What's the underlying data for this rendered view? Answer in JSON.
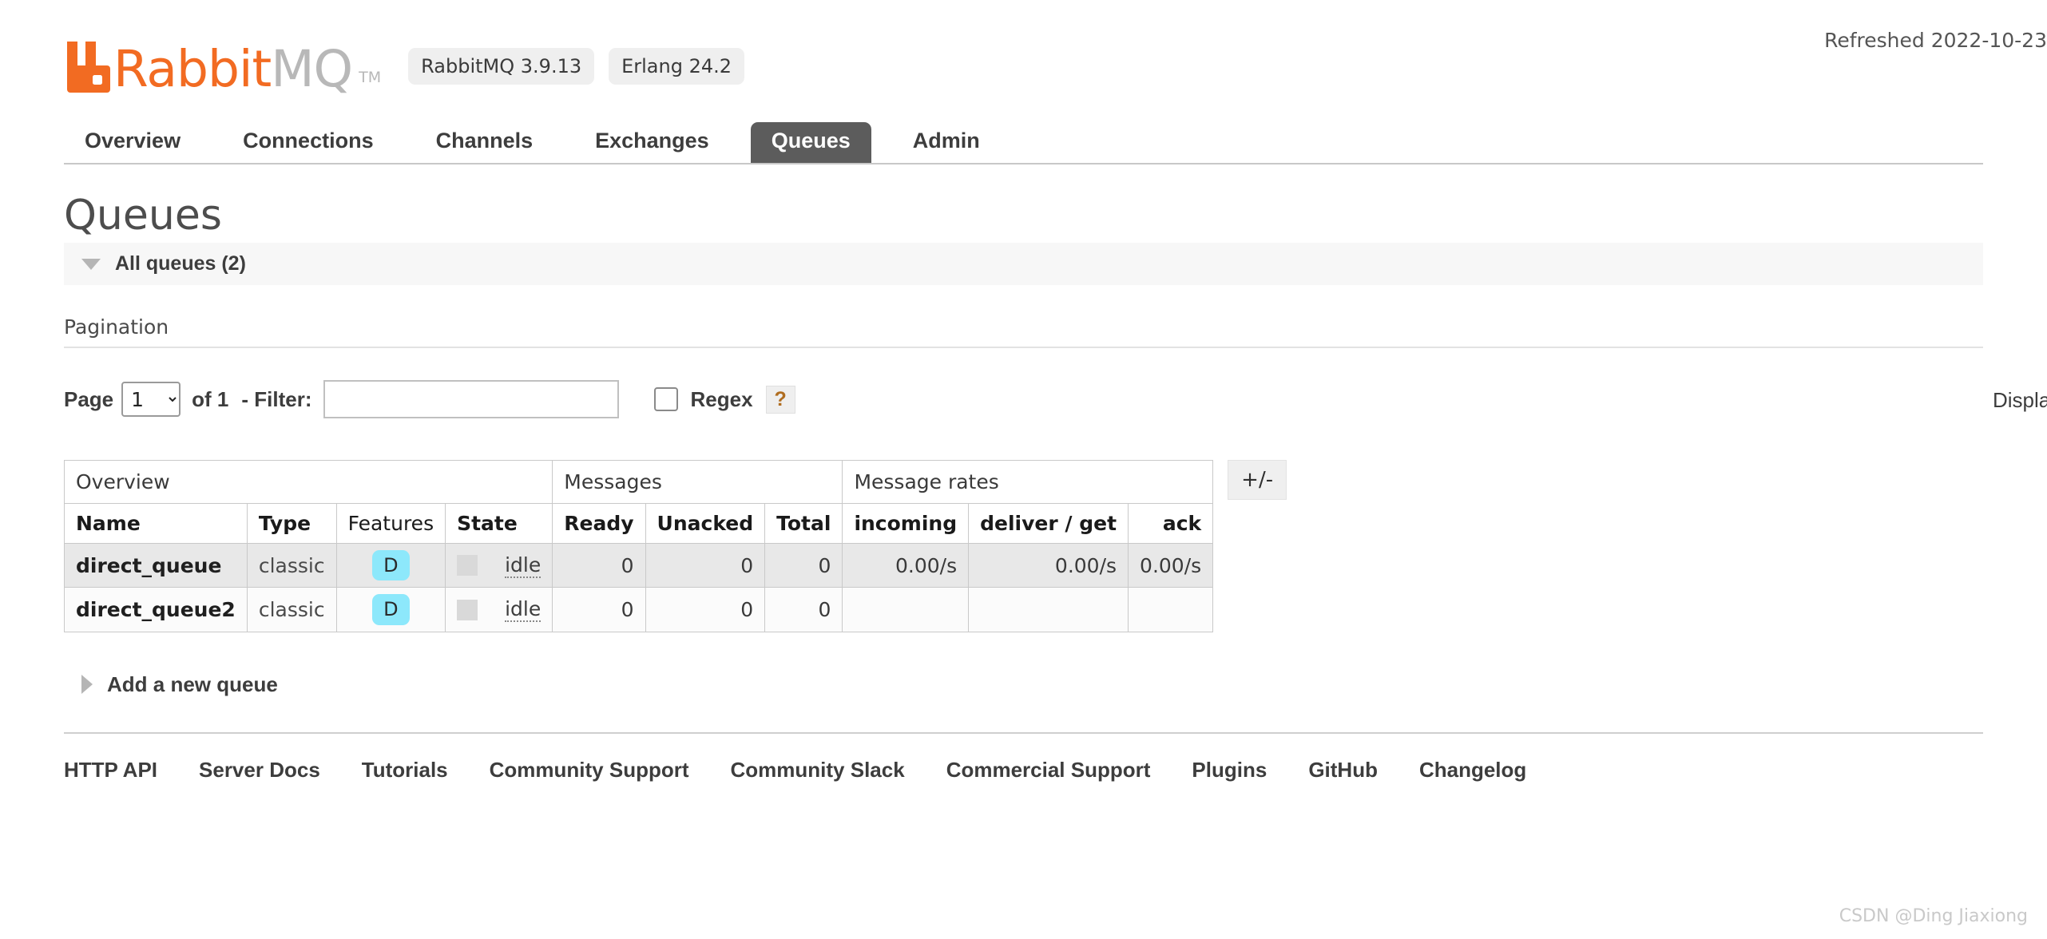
{
  "header": {
    "logo": {
      "mark_icon": "rabbitmq-logo-icon",
      "text_primary": "Rabbit",
      "text_secondary": "MQ",
      "trademark": "TM",
      "color_orange": "#f26b22",
      "color_grey": "#b8b8b8"
    },
    "badges": [
      {
        "label": "RabbitMQ 3.9.13"
      },
      {
        "label": "Erlang 24.2"
      }
    ],
    "refreshed": "Refreshed 2022-10-23"
  },
  "nav": {
    "tabs": [
      {
        "label": "Overview",
        "active": false
      },
      {
        "label": "Connections",
        "active": false
      },
      {
        "label": "Channels",
        "active": false
      },
      {
        "label": "Exchanges",
        "active": false
      },
      {
        "label": "Queues",
        "active": true
      },
      {
        "label": "Admin",
        "active": false
      }
    ]
  },
  "main": {
    "page_title": "Queues",
    "all_queues_section": "All queues (2)",
    "pagination_heading": "Pagination",
    "filter": {
      "page_label": "Page",
      "page_value": "1",
      "page_options": [
        "1"
      ],
      "of_label": "of 1",
      "filter_label": "- Filter:",
      "filter_value": "",
      "filter_placeholder": "",
      "regex_label": "Regex",
      "regex_checked": false,
      "help_label": "?",
      "display_label": "Displa"
    },
    "table": {
      "group_headers": [
        {
          "label": "Overview",
          "span": 4
        },
        {
          "label": "Messages",
          "span": 3
        },
        {
          "label": "Message rates",
          "span": 3
        }
      ],
      "columns": [
        {
          "label": "Name",
          "sortable": true,
          "align": "left"
        },
        {
          "label": "Type",
          "sortable": true,
          "align": "left"
        },
        {
          "label": "Features",
          "sortable": false,
          "align": "left"
        },
        {
          "label": "State",
          "sortable": true,
          "align": "left"
        },
        {
          "label": "Ready",
          "sortable": true,
          "align": "right"
        },
        {
          "label": "Unacked",
          "sortable": true,
          "align": "right"
        },
        {
          "label": "Total",
          "sortable": true,
          "align": "right"
        },
        {
          "label": "incoming",
          "sortable": true,
          "align": "right"
        },
        {
          "label": "deliver / get",
          "sortable": true,
          "align": "right"
        },
        {
          "label": "ack",
          "sortable": true,
          "align": "right"
        }
      ],
      "toggle_columns_label": "+/-",
      "rows": [
        {
          "name": "direct_queue",
          "type": "classic",
          "features": "D",
          "state": "idle",
          "ready": "0",
          "unacked": "0",
          "total": "0",
          "incoming": "0.00/s",
          "deliver_get": "0.00/s",
          "ack": "0.00/s"
        },
        {
          "name": "direct_queue2",
          "type": "classic",
          "features": "D",
          "state": "idle",
          "ready": "0",
          "unacked": "0",
          "total": "0",
          "incoming": "",
          "deliver_get": "",
          "ack": ""
        }
      ]
    },
    "add_queue_label": "Add a new queue"
  },
  "footer": {
    "links": [
      {
        "label": "HTTP API"
      },
      {
        "label": "Server Docs"
      },
      {
        "label": "Tutorials"
      },
      {
        "label": "Community Support"
      },
      {
        "label": "Community Slack"
      },
      {
        "label": "Commercial Support"
      },
      {
        "label": "Plugins"
      },
      {
        "label": "GitHub"
      },
      {
        "label": "Changelog"
      }
    ]
  },
  "watermark": "CSDN @Ding Jiaxiong"
}
